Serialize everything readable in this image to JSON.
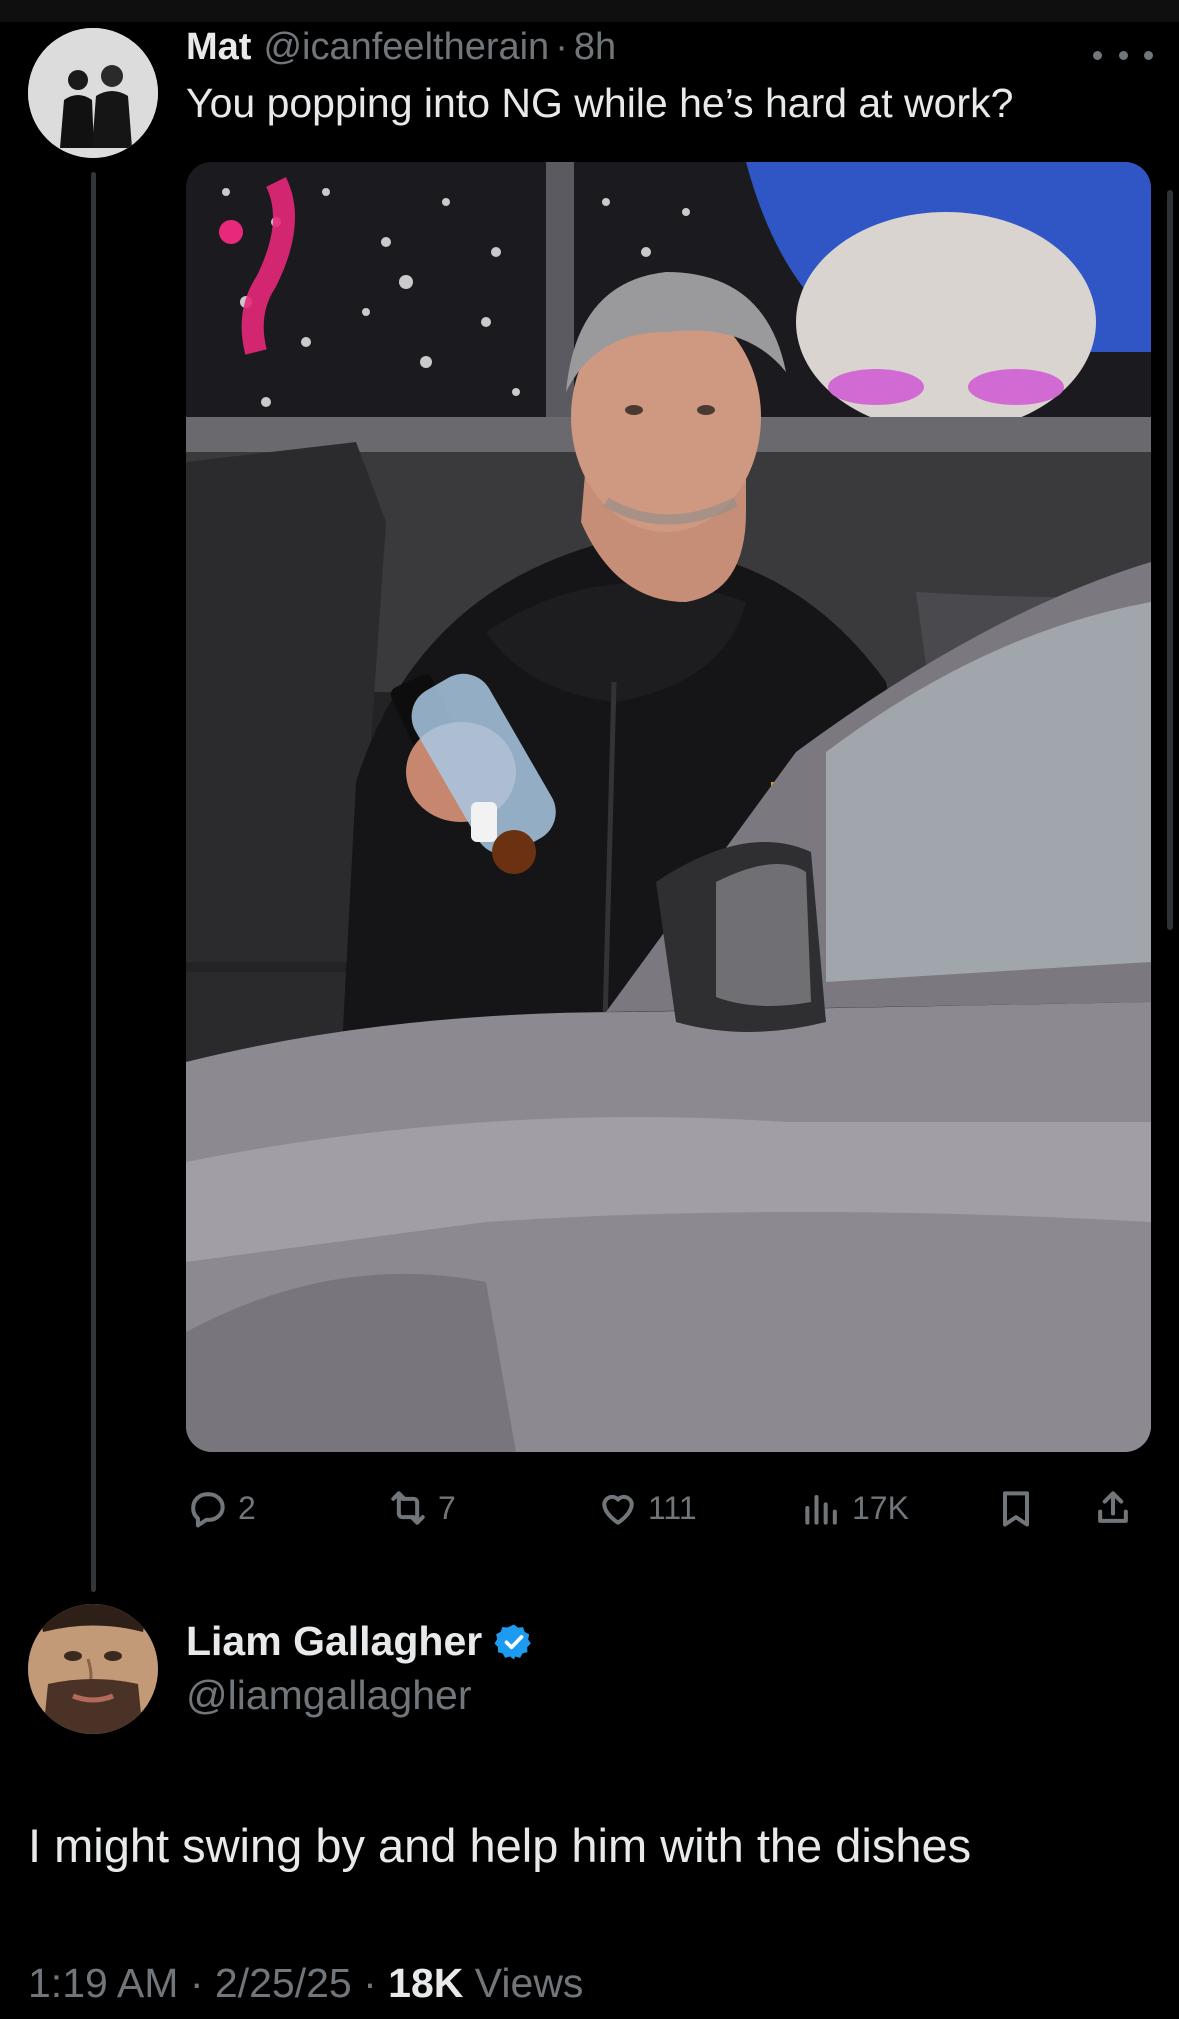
{
  "parent_tweet": {
    "author_name": "Mat",
    "handle": "@icanfeeltherain",
    "separator": "·",
    "time": "8h",
    "text": "You popping into NG while he’s hard at work?",
    "media_icon": "photo",
    "actions": {
      "reply_count": "2",
      "retweet_count": "7",
      "like_count": "111",
      "views_count": "17K"
    },
    "icons": [
      "reply-icon",
      "retweet-icon",
      "like-icon",
      "views-icon",
      "bookmark-icon",
      "share-icon",
      "more-icon"
    ]
  },
  "reply_tweet": {
    "author_name": "Liam Gallagher",
    "handle": "@liamgallagher",
    "verified": true,
    "verified_color": "#1d9bf0",
    "text": "I might swing by and help him with the dishes",
    "time": "1:19 AM",
    "separator": "·",
    "date": "2/25/25",
    "views_count": "18K",
    "views_label": "Views"
  },
  "colors": {
    "background": "#000000",
    "primary_text": "#e7e9ea",
    "secondary_text": "#71767b",
    "thread_line": "#333639"
  }
}
